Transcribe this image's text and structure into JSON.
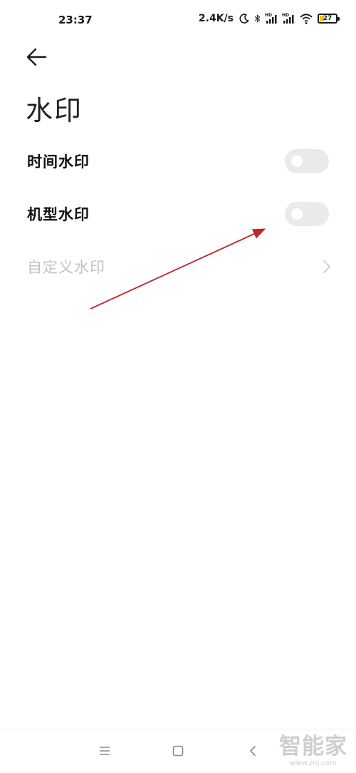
{
  "status_bar": {
    "time": "23:37",
    "net_speed": "2.4K/s",
    "battery_level": "27",
    "battery_fraction": 0.27,
    "icons": [
      "moon-icon",
      "bluetooth-icon",
      "signal-hd-icon",
      "signal-hd-icon",
      "wifi-icon",
      "battery-icon"
    ]
  },
  "header": {
    "back_icon": "back-arrow-icon",
    "title": "水印"
  },
  "settings": {
    "time_watermark": {
      "label": "时间水印",
      "enabled": false
    },
    "model_watermark": {
      "label": "机型水印",
      "enabled": false
    },
    "custom_watermark": {
      "label": "自定义水印",
      "disabled": true,
      "icon": "chevron-right-icon"
    }
  },
  "annotation": {
    "type": "red-arrow",
    "color": "#c0262c"
  },
  "nav_bar": {
    "icons": [
      "menu-icon",
      "home-icon",
      "back-icon"
    ]
  },
  "watermark": {
    "logo": "智能家",
    "url": "www.znj.com"
  },
  "colors": {
    "background": "#ffffff",
    "toggle_off": "#eaeaea",
    "disabled_text": "#c2c2c2",
    "battery_fill": "#f5c400",
    "arrow": "#c0262c"
  }
}
